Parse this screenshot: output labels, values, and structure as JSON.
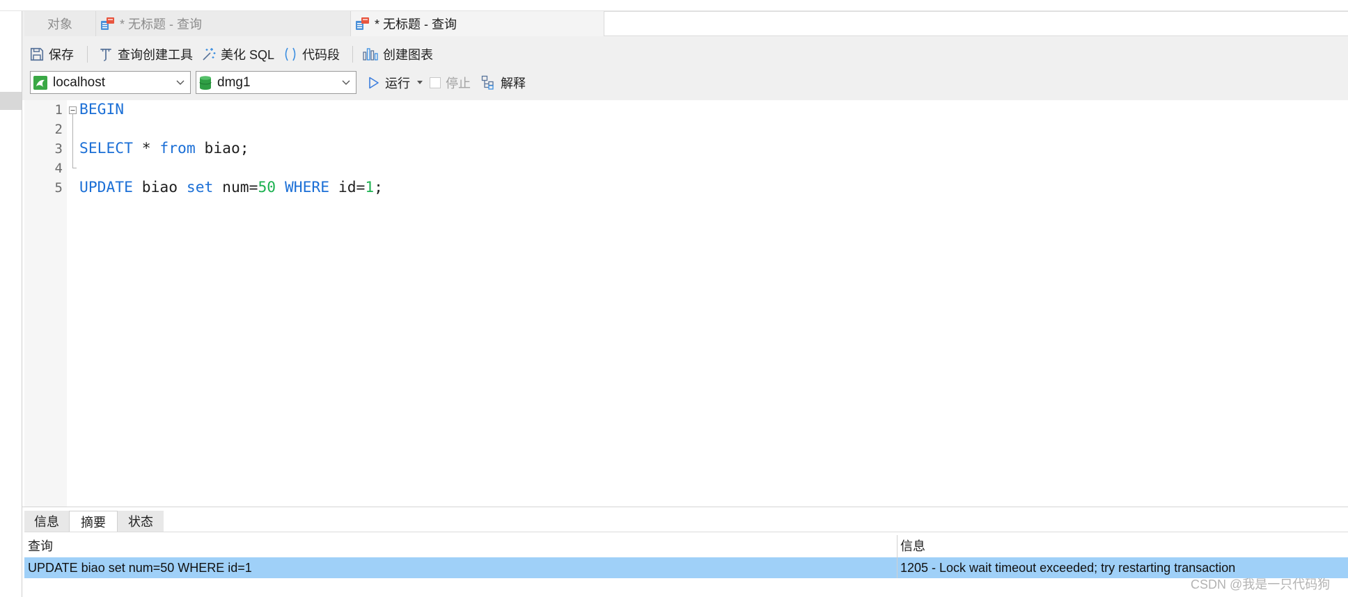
{
  "tabs": [
    {
      "label": "对象"
    },
    {
      "label": "* 无标题 - 查询"
    },
    {
      "label": "* 无标题 - 查询",
      "active": true
    }
  ],
  "toolbar": {
    "save": "保存",
    "query_builder": "查询创建工具",
    "beautify_sql": "美化 SQL",
    "code_snippet": "代码段",
    "create_chart": "创建图表"
  },
  "connection": {
    "server": "localhost",
    "database": "dmg1"
  },
  "run_bar": {
    "run": "运行",
    "stop": "停止",
    "explain": "解释",
    "stop_enabled": false
  },
  "editor": {
    "line_numbers": [
      "1",
      "2",
      "3",
      "4",
      "5"
    ],
    "lines": [
      {
        "tokens": [
          {
            "text": "BEGIN",
            "color": "#1b6fd6"
          }
        ]
      },
      {
        "tokens": []
      },
      {
        "tokens": [
          {
            "text": "SELECT",
            "color": "#1b6fd6"
          },
          {
            "text": " * ",
            "color": "#1f1f1f"
          },
          {
            "text": "from",
            "color": "#1b6fd6"
          },
          {
            "text": " biao;",
            "color": "#1f1f1f"
          }
        ]
      },
      {
        "tokens": []
      },
      {
        "tokens": [
          {
            "text": "UPDATE",
            "color": "#1b6fd6"
          },
          {
            "text": " biao ",
            "color": "#1f1f1f"
          },
          {
            "text": "set",
            "color": "#1b6fd6"
          },
          {
            "text": " num=",
            "color": "#1f1f1f"
          },
          {
            "text": "50",
            "color": "#1cb150"
          },
          {
            "text": " ",
            "color": "#1f1f1f"
          },
          {
            "text": "WHERE",
            "color": "#1b6fd6"
          },
          {
            "text": " id=",
            "color": "#1f1f1f"
          },
          {
            "text": "1",
            "color": "#1cb150"
          },
          {
            "text": ";",
            "color": "#1f1f1f"
          }
        ]
      }
    ]
  },
  "result_panel": {
    "tabs": [
      {
        "label": "信息"
      },
      {
        "label": "摘要",
        "active": true
      },
      {
        "label": "状态"
      }
    ],
    "columns": [
      "查询",
      "信息"
    ],
    "rows": [
      {
        "query": "UPDATE biao set num=50 WHERE id=1",
        "message": "1205 - Lock wait timeout exceeded; try restarting transaction",
        "selected": true
      }
    ]
  },
  "watermark": "CSDN @我是一只代码狗",
  "colors": {
    "keyword": "#1b6fd6",
    "number": "#1cb150",
    "selection": "#9fd0f8",
    "toolbar_bg": "#f0f0f0"
  },
  "icons": {
    "tab": "query-icon",
    "save": "save-icon",
    "query_builder": "query-builder-icon",
    "beautify_sql": "magic-wand-icon",
    "code_snippet": "parentheses-icon",
    "create_chart": "bar-chart-icon",
    "server": "mysql-connection-icon",
    "database": "database-icon",
    "run": "play-icon",
    "stop": "stop-icon",
    "explain": "explain-tree-icon"
  }
}
